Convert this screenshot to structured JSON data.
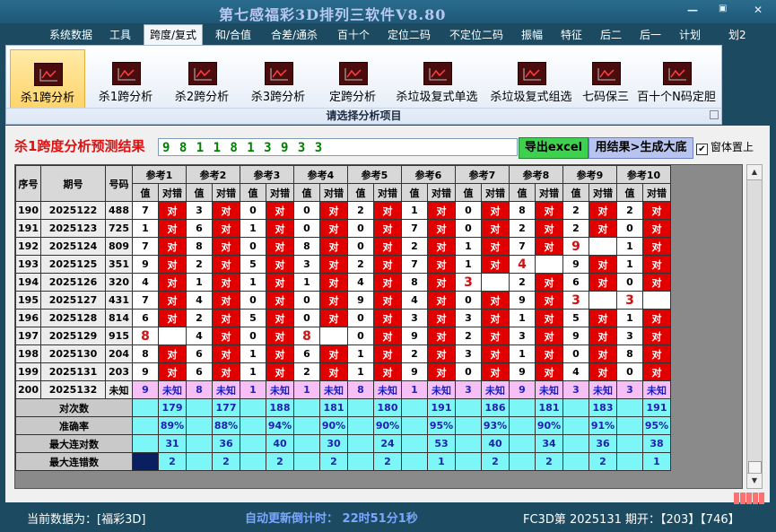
{
  "window": {
    "title": "第七感福彩3D排列三软件V8.80",
    "minimize_glyph": "—",
    "restore_glyph": "▣",
    "close_glyph": "✕"
  },
  "menu": [
    "系统数据",
    "工具",
    "跨度/复式",
    "和/合值",
    "合差/通杀",
    "百十个",
    "定位二码",
    "不定位二码",
    "振幅",
    "特征",
    "后二",
    "后一",
    "计划",
    "划2"
  ],
  "ribbon": {
    "buttons": [
      "杀1跨分析",
      "杀1跨分析",
      "杀2跨分析",
      "杀3跨分析",
      "定跨分析",
      "杀垃圾复式单选",
      "杀垃圾复式组选",
      "七码保三",
      "百十个N码定胆"
    ],
    "group_label": "请选择分析项目"
  },
  "result": {
    "label": "杀1跨度分析预测结果",
    "value": "9 8 1 1 8 1 3 9 3 3",
    "export_label": "导出excel",
    "generate_label": "用结果>生成大底",
    "pin_label": "窗体置上",
    "pin_checked": "✔"
  },
  "table": {
    "head_seq": "序号",
    "head_issue": "期号",
    "head_num": "号码",
    "ref_headers": [
      "参考1",
      "参考2",
      "参考3",
      "参考4",
      "参考5",
      "参考6",
      "参考7",
      "参考8",
      "参考9",
      "参考10"
    ],
    "sub_val": "值",
    "sub_res": "对错",
    "ok_text": "对",
    "rows": [
      {
        "seq": "190",
        "issue": "2025122",
        "num": "488",
        "vals": [
          7,
          3,
          0,
          0,
          2,
          1,
          0,
          8,
          2,
          2
        ],
        "ok": [
          1,
          1,
          1,
          1,
          1,
          1,
          1,
          1,
          1,
          1
        ]
      },
      {
        "seq": "191",
        "issue": "2025123",
        "num": "725",
        "vals": [
          1,
          6,
          1,
          0,
          0,
          7,
          0,
          2,
          2,
          0
        ],
        "ok": [
          1,
          1,
          1,
          1,
          1,
          1,
          1,
          1,
          1,
          1
        ]
      },
      {
        "seq": "192",
        "issue": "2025124",
        "num": "809",
        "vals": [
          7,
          8,
          0,
          8,
          0,
          2,
          1,
          7,
          9,
          1
        ],
        "ok": [
          1,
          1,
          1,
          1,
          1,
          1,
          1,
          1,
          0,
          1
        ]
      },
      {
        "seq": "193",
        "issue": "2025125",
        "num": "351",
        "vals": [
          9,
          2,
          5,
          3,
          2,
          7,
          1,
          4,
          9,
          1
        ],
        "ok": [
          1,
          1,
          1,
          1,
          1,
          1,
          1,
          0,
          1,
          1
        ]
      },
      {
        "seq": "194",
        "issue": "2025126",
        "num": "320",
        "vals": [
          4,
          1,
          1,
          1,
          4,
          8,
          3,
          2,
          6,
          0
        ],
        "ok": [
          1,
          1,
          1,
          1,
          1,
          1,
          0,
          1,
          1,
          1
        ]
      },
      {
        "seq": "195",
        "issue": "2025127",
        "num": "431",
        "vals": [
          7,
          4,
          0,
          0,
          9,
          4,
          0,
          9,
          3,
          3
        ],
        "ok": [
          1,
          1,
          1,
          1,
          1,
          1,
          1,
          1,
          0,
          0
        ]
      },
      {
        "seq": "196",
        "issue": "2025128",
        "num": "814",
        "vals": [
          6,
          2,
          5,
          0,
          0,
          3,
          3,
          1,
          5,
          1
        ],
        "ok": [
          1,
          1,
          1,
          1,
          1,
          1,
          1,
          1,
          1,
          1
        ]
      },
      {
        "seq": "197",
        "issue": "2025129",
        "num": "915",
        "vals": [
          8,
          4,
          0,
          8,
          0,
          9,
          2,
          3,
          9,
          3
        ],
        "ok": [
          0,
          1,
          1,
          0,
          1,
          1,
          1,
          1,
          1,
          1
        ]
      },
      {
        "seq": "198",
        "issue": "2025130",
        "num": "204",
        "vals": [
          8,
          6,
          1,
          6,
          1,
          2,
          3,
          1,
          0,
          8
        ],
        "ok": [
          1,
          1,
          1,
          1,
          1,
          1,
          1,
          1,
          1,
          1
        ]
      },
      {
        "seq": "199",
        "issue": "2025131",
        "num": "203",
        "vals": [
          9,
          6,
          1,
          2,
          1,
          9,
          0,
          9,
          4,
          0
        ],
        "ok": [
          1,
          1,
          1,
          1,
          1,
          1,
          1,
          1,
          1,
          1
        ]
      }
    ],
    "pending": {
      "seq": "200",
      "issue": "2025132",
      "num": "未知",
      "vals": [
        9,
        8,
        1,
        1,
        8,
        1,
        3,
        9,
        3,
        3
      ],
      "res": "未知"
    },
    "stat_labels": [
      "对次数",
      "准确率",
      "最大连对数",
      "最大连错数"
    ],
    "stats": {
      "hits": [
        "179",
        "177",
        "188",
        "181",
        "180",
        "191",
        "186",
        "181",
        "183",
        "191"
      ],
      "accuracy": [
        "89%",
        "88%",
        "94%",
        "90%",
        "90%",
        "95%",
        "93%",
        "90%",
        "91%",
        "95%"
      ],
      "max_hit_streak": [
        "31",
        "36",
        "40",
        "30",
        "24",
        "53",
        "40",
        "34",
        "36",
        "38"
      ],
      "max_miss_streak": [
        "2",
        "2",
        "2",
        "2",
        "2",
        "1",
        "2",
        "2",
        "2",
        "1"
      ]
    }
  },
  "status": {
    "data_source": "当前数据为：[福彩3D]",
    "countdown": "自动更新倒计时：  22时51分1秒",
    "draw_info": "FC3D第 2025131 期开：【203】【746】"
  },
  "colors": {
    "ok_red": "#e00000",
    "stat_cyan": "#7cf6f6",
    "pending_pink": "#f6c0f6",
    "excel_green": "#3fd050"
  }
}
